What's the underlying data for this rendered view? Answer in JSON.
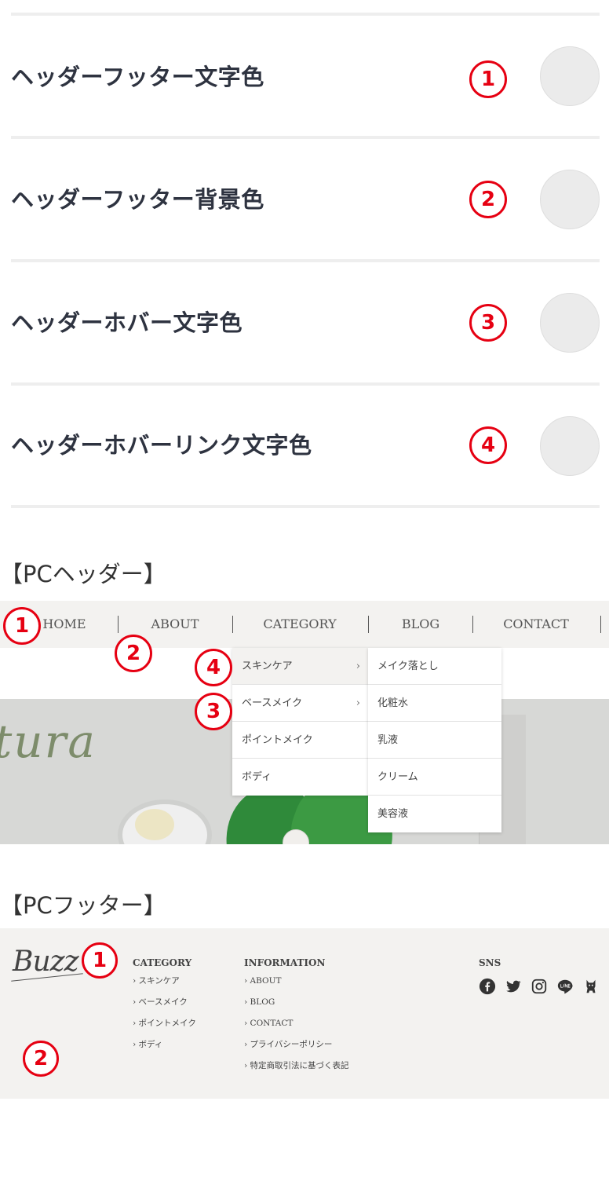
{
  "settings": {
    "rows": [
      {
        "label": "ヘッダーフッター文字色",
        "number": "1"
      },
      {
        "label": "ヘッダーフッター背景色",
        "number": "2"
      },
      {
        "label": "ヘッダーホバー文字色",
        "number": "3"
      },
      {
        "label": "ヘッダーホバーリンク文字色",
        "number": "4"
      }
    ]
  },
  "pc_header": {
    "title": "【PCヘッダー】",
    "nav": [
      "HOME",
      "ABOUT",
      "CATEGORY",
      "BLOG",
      "CONTACT"
    ],
    "markers": [
      "1",
      "2",
      "3",
      "4"
    ],
    "submenu": [
      {
        "label": "スキンケア",
        "arrow": "›"
      },
      {
        "label": "ベースメイク",
        "arrow": "›"
      },
      {
        "label": "ポイントメイク"
      },
      {
        "label": "ボディ"
      }
    ],
    "subsubmenu": [
      "メイク落とし",
      "化粧水",
      "乳液",
      "クリーム",
      "美容液"
    ],
    "hero_script": "tura"
  },
  "pc_footer": {
    "title": "【PCフッター】",
    "logo_text": "Buzz",
    "markers": [
      "1",
      "2"
    ],
    "category": {
      "heading": "CATEGORY",
      "links": [
        "› スキンケア",
        "› ベースメイク",
        "› ポイントメイク",
        "› ボディ"
      ]
    },
    "information": {
      "heading": "INFORMATION",
      "links": [
        "› ABOUT",
        "› BLOG",
        "› CONTACT",
        "› プライバシーポリシー",
        "› 特定商取引法に基づく表記"
      ]
    },
    "sns": {
      "heading": "SNS",
      "icons": [
        "facebook-icon",
        "twitter-icon",
        "instagram-icon",
        "line-icon",
        "cat-icon"
      ]
    }
  },
  "colors": {
    "marker_red": "#e60012",
    "nav_background": "#f3f2f0",
    "footer_background": "#f3f2f0",
    "swatch": "#ebebeb",
    "label_text": "#2e3340"
  }
}
